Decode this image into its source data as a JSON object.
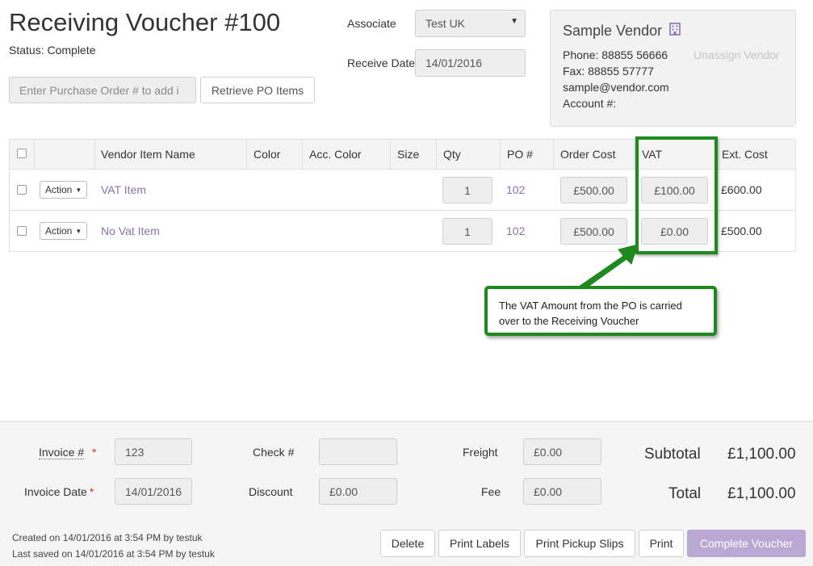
{
  "header": {
    "title": "Receiving Voucher #100",
    "status": "Status: Complete",
    "po_placeholder": "Enter Purchase Order # to add i",
    "retrieve_label": "Retrieve PO Items",
    "associate_label": "Associate",
    "associate_value": "Test UK",
    "receive_date_label": "Receive Date",
    "receive_date_value": "14/01/2016"
  },
  "vendor": {
    "name": "Sample Vendor",
    "phone": "Phone: 88855 56666",
    "fax": "Fax: 88855 57777",
    "email": "sample@vendor.com",
    "account": "Account #:",
    "unassign": "Unassign Vendor",
    "icon": "building-icon"
  },
  "table": {
    "columns": [
      "Vendor Item Name",
      "Color",
      "Acc. Color",
      "Size",
      "Qty",
      "PO #",
      "Order Cost",
      "VAT",
      "Ext. Cost"
    ],
    "action_label": "Action",
    "rows": [
      {
        "name": "VAT Item",
        "qty": "1",
        "po": "102",
        "order_cost": "£500.00",
        "vat": "£100.00",
        "ext_cost": "£600.00"
      },
      {
        "name": "No Vat Item",
        "qty": "1",
        "po": "102",
        "order_cost": "£500.00",
        "vat": "£0.00",
        "ext_cost": "£500.00"
      }
    ]
  },
  "annotation": {
    "text": "The VAT Amount from the PO is carried over to the Receiving Voucher",
    "color": "#1e8a1e"
  },
  "footer": {
    "invoice_label": "Invoice #",
    "invoice_value": "123",
    "invoice_date_label": "Invoice Date",
    "invoice_date_value": "14/01/2016",
    "required_mark": "*",
    "check_label": "Check #",
    "check_value": "",
    "discount_label": "Discount",
    "discount_value": "£0.00",
    "freight_label": "Freight",
    "freight_value": "£0.00",
    "fee_label": "Fee",
    "fee_value": "£0.00",
    "subtotal_label": "Subtotal",
    "subtotal_value": "£1,100.00",
    "total_label": "Total",
    "total_value": "£1,100.00",
    "created": "Created on 14/01/2016 at 3:54 PM by testuk",
    "saved": "Last saved on 14/01/2016 at 3:54 PM by testuk",
    "buttons": {
      "delete": "Delete",
      "print_labels": "Print Labels",
      "print_pickup": "Print Pickup Slips",
      "print": "Print",
      "complete": "Complete Voucher"
    }
  },
  "colors": {
    "accent": "#8a73a8",
    "complete_button": "#b9a8d3",
    "highlight": "#1e8a1e"
  }
}
